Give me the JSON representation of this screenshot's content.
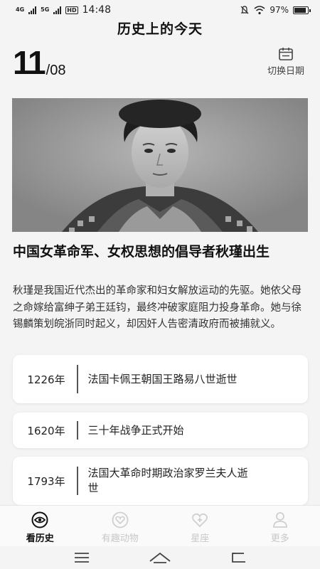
{
  "status_bar": {
    "signal1": "4G",
    "signal2": "5G",
    "hd": "HD",
    "time": "14:48",
    "battery": "97%",
    "battery_level": 0.97
  },
  "header": {
    "title": "历史上的今天",
    "day": "11",
    "month": "/08",
    "switch_date_label": "切换日期"
  },
  "featured": {
    "image_icon": "portrait-photo",
    "headline": "中国女革命军、女权思想的倡导者秋瑾出生",
    "summary": "秋瑾是我国近代杰出的革命家和妇女解放运动的先驱。她依父母之命嫁给富绅子弟王廷钧，最终冲破家庭阻力投身革命。她与徐锡麟策划皖浙同时起义，却因奸人告密清政府而被捕就义。"
  },
  "events": [
    {
      "year": "1226年",
      "text": "法国卡佩王朝国王路易八世逝世"
    },
    {
      "year": "1620年",
      "text": "三十年战争正式开始"
    },
    {
      "year": "1793年",
      "text": "法国大革命时期政治家罗兰夫人逝世"
    }
  ],
  "tabs": [
    {
      "label": "看历史",
      "icon": "eye-icon",
      "active": true
    },
    {
      "label": "有趣动物",
      "icon": "heart-icon",
      "active": false
    },
    {
      "label": "星座",
      "icon": "heart-plus-icon",
      "active": false
    },
    {
      "label": "更多",
      "icon": "person-icon",
      "active": false
    }
  ],
  "nav": {
    "icons": [
      "menu-icon",
      "home-icon",
      "back-icon"
    ]
  }
}
